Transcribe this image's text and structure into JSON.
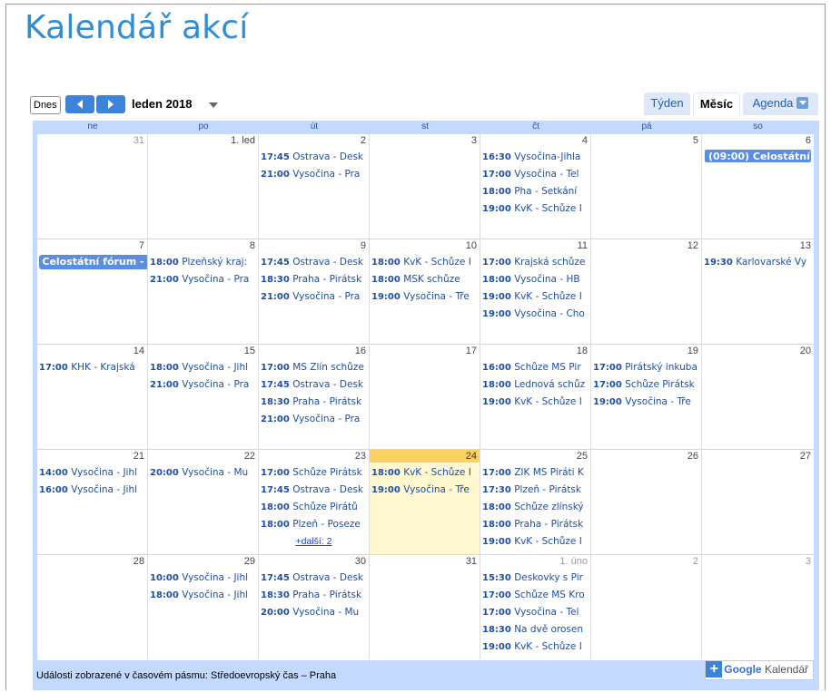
{
  "page": {
    "title": "Kalendář akcí"
  },
  "toolbar": {
    "today_label": "Dnes",
    "prev_icon": "chevron-left-icon",
    "next_icon": "chevron-right-icon",
    "month_label": "leden 2018",
    "views": [
      "Týden",
      "Měsíc",
      "Agenda"
    ],
    "active_view": "Měsíc"
  },
  "weekdays": [
    "ne",
    "po",
    "út",
    "st",
    "čt",
    "pá",
    "so"
  ],
  "weeks": [
    {
      "days": [
        {
          "num": "31",
          "other": true,
          "events": []
        },
        {
          "num": "1. led",
          "events": []
        },
        {
          "num": "2",
          "events": [
            {
              "time": "17:45",
              "title": "Ostrava - Desk"
            },
            {
              "time": "21:00",
              "title": "Vysočina - Pra"
            }
          ]
        },
        {
          "num": "3",
          "events": []
        },
        {
          "num": "4",
          "events": [
            {
              "time": "16:30",
              "title": "Vysočina-Jihla"
            },
            {
              "time": "17:00",
              "title": "Vysočina - Tel"
            },
            {
              "time": "18:00",
              "title": "Pha - Setkání"
            },
            {
              "time": "19:00",
              "title": "KvK - Schůze I"
            }
          ]
        },
        {
          "num": "5",
          "events": []
        },
        {
          "num": "6",
          "allday": "(09:00) Celostátní",
          "events": []
        }
      ]
    },
    {
      "days": [
        {
          "num": "7",
          "allday": "Celostátní fórum -",
          "events": []
        },
        {
          "num": "8",
          "events": [
            {
              "time": "18:00",
              "title": "Plzeňský kraj:"
            },
            {
              "time": "21:00",
              "title": "Vysočina - Pra"
            }
          ]
        },
        {
          "num": "9",
          "events": [
            {
              "time": "17:45",
              "title": "Ostrava - Desk"
            },
            {
              "time": "18:30",
              "title": "Praha - Pirátsk"
            },
            {
              "time": "21:00",
              "title": "Vysočina - Pra"
            }
          ]
        },
        {
          "num": "10",
          "events": [
            {
              "time": "18:00",
              "title": "KvK - Schůze I"
            },
            {
              "time": "18:00",
              "title": "MSK schůze"
            },
            {
              "time": "19:00",
              "title": "Vysočina - Tře"
            }
          ]
        },
        {
          "num": "11",
          "events": [
            {
              "time": "17:00",
              "title": "Krajská schůze"
            },
            {
              "time": "18:00",
              "title": "Vysočina - HB"
            },
            {
              "time": "19:00",
              "title": "KvK - Schůze I"
            },
            {
              "time": "19:00",
              "title": "Vysočina - Cho"
            }
          ]
        },
        {
          "num": "12",
          "events": []
        },
        {
          "num": "13",
          "events": [
            {
              "time": "19:30",
              "title": "Karlovarské Vy"
            }
          ]
        }
      ]
    },
    {
      "days": [
        {
          "num": "14",
          "events": [
            {
              "time": "17:00",
              "title": "KHK - Krajská"
            }
          ]
        },
        {
          "num": "15",
          "events": [
            {
              "time": "18:00",
              "title": "Vysočina - Jihl"
            },
            {
              "time": "21:00",
              "title": "Vysočina - Pra"
            }
          ]
        },
        {
          "num": "16",
          "events": [
            {
              "time": "17:00",
              "title": "MS Zlín schůze"
            },
            {
              "time": "17:45",
              "title": "Ostrava - Desk"
            },
            {
              "time": "18:30",
              "title": "Praha - Pirátsk"
            },
            {
              "time": "21:00",
              "title": "Vysočina - Pra"
            }
          ]
        },
        {
          "num": "17",
          "events": []
        },
        {
          "num": "18",
          "events": [
            {
              "time": "16:00",
              "title": "Schůze MS Pir"
            },
            {
              "time": "18:00",
              "title": "Lednová schůz"
            },
            {
              "time": "19:00",
              "title": "KvK - Schůze I"
            }
          ]
        },
        {
          "num": "19",
          "events": [
            {
              "time": "17:00",
              "title": "Pirátský inkuba"
            },
            {
              "time": "17:00",
              "title": "Schůze Pirátsk"
            },
            {
              "time": "19:00",
              "title": "Vysočina - Tře"
            }
          ]
        },
        {
          "num": "20",
          "events": []
        }
      ]
    },
    {
      "days": [
        {
          "num": "21",
          "events": [
            {
              "time": "14:00",
              "title": "Vysočina - Jihl"
            },
            {
              "time": "16:00",
              "title": "Vysočina - Jihl"
            }
          ]
        },
        {
          "num": "22",
          "events": [
            {
              "time": "20:00",
              "title": "Vysočina - Mu"
            }
          ]
        },
        {
          "num": "23",
          "events": [
            {
              "time": "17:00",
              "title": "Schůze Pirátsk"
            },
            {
              "time": "17:45",
              "title": "Ostrava - Desk"
            },
            {
              "time": "18:00",
              "title": "Schůze Pirátů"
            },
            {
              "time": "18:00",
              "title": "Plzeň - Poseze"
            }
          ],
          "more": "+další: 2"
        },
        {
          "num": "24",
          "today": true,
          "events": [
            {
              "time": "18:00",
              "title": "KvK - Schůze I"
            },
            {
              "time": "19:00",
              "title": "Vysočina - Tře"
            }
          ]
        },
        {
          "num": "25",
          "events": [
            {
              "time": "17:00",
              "title": "ZIK MS Piráti K"
            },
            {
              "time": "17:30",
              "title": "Plzeň - Pirátsk"
            },
            {
              "time": "18:00",
              "title": "Schůze zlínský"
            },
            {
              "time": "18:00",
              "title": "Praha - Pirátsk"
            },
            {
              "time": "19:00",
              "title": "KvK - Schůze I"
            }
          ]
        },
        {
          "num": "26",
          "events": []
        },
        {
          "num": "27",
          "events": []
        }
      ]
    },
    {
      "days": [
        {
          "num": "28",
          "events": []
        },
        {
          "num": "29",
          "events": [
            {
              "time": "10:00",
              "title": "Vysočina - Jihl"
            },
            {
              "time": "18:00",
              "title": "Vysočina - Jihl"
            }
          ]
        },
        {
          "num": "30",
          "events": [
            {
              "time": "17:45",
              "title": "Ostrava - Desk"
            },
            {
              "time": "18:30",
              "title": "Praha - Pirátsk"
            },
            {
              "time": "20:00",
              "title": "Vysočina - Mu"
            }
          ]
        },
        {
          "num": "31",
          "events": []
        },
        {
          "num": "1. úno",
          "other": true,
          "events": [
            {
              "time": "15:30",
              "title": "Deskovky s Pir"
            },
            {
              "time": "17:00",
              "title": "Schůze MS Kro"
            },
            {
              "time": "17:00",
              "title": "Vysočina - Tel"
            },
            {
              "time": "18:30",
              "title": "Na dvě orosen"
            },
            {
              "time": "19:00",
              "title": "KvK - Schůze I"
            }
          ]
        },
        {
          "num": "2",
          "other": true,
          "events": []
        },
        {
          "num": "3",
          "other": true,
          "events": []
        }
      ]
    }
  ],
  "footer": {
    "timezone_text": "Události zobrazené v časovém pásmu: Středoevropský čas – Praha",
    "badge_plus": "+",
    "badge_google": "Google",
    "badge_calendar": "Kalendář"
  },
  "colors": {
    "accent": "#3b84d9",
    "grid_bg": "#c3d9ff",
    "today": "#fff7d0",
    "event_text": "#1d4fa6"
  }
}
